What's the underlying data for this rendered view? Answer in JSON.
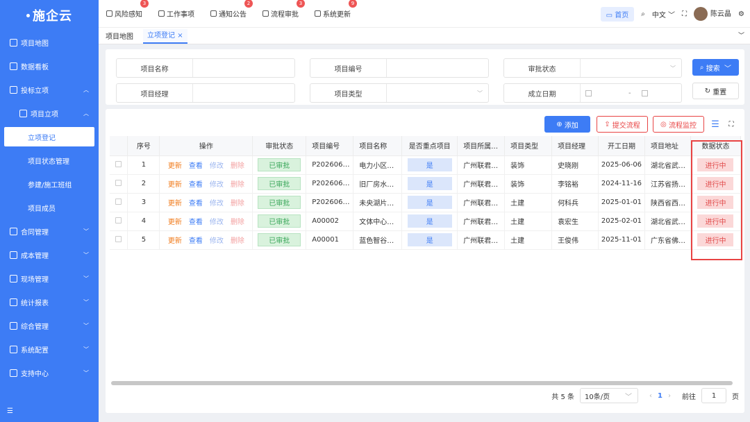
{
  "app": {
    "logo": "施企云"
  },
  "sidebar": {
    "items": [
      {
        "label": "项目地图",
        "icon": "home-icon"
      },
      {
        "label": "数据看板",
        "icon": "monitor-icon"
      },
      {
        "label": "投标立项",
        "icon": "briefcase-icon",
        "chevron": "^"
      },
      {
        "label": "项目立项",
        "icon": "doc-icon",
        "chevron": "^"
      },
      {
        "label": "立项登记"
      },
      {
        "label": "项目状态管理"
      },
      {
        "label": "参建/施工班组"
      },
      {
        "label": "项目成员"
      },
      {
        "label": "合同管理",
        "icon": "contract-icon",
        "chevron": "v"
      },
      {
        "label": "成本管理",
        "icon": "cost-icon",
        "chevron": "v"
      },
      {
        "label": "现场管理",
        "icon": "site-icon",
        "chevron": "v"
      },
      {
        "label": "统计报表",
        "icon": "grid-icon",
        "chevron": "v"
      },
      {
        "label": "综合管理",
        "icon": "table-icon",
        "chevron": "v"
      },
      {
        "label": "系统配置",
        "icon": "grid-icon",
        "chevron": "v"
      },
      {
        "label": "支持中心",
        "icon": "help-icon",
        "chevron": "v"
      }
    ]
  },
  "topbar": {
    "items": [
      {
        "label": "风险感知",
        "badge": "3"
      },
      {
        "label": "工作事项",
        "badge": ""
      },
      {
        "label": "通知公告",
        "badge": "2"
      },
      {
        "label": "流程审批",
        "badge": "3"
      },
      {
        "label": "系统更新",
        "badge": "9"
      }
    ],
    "home": "首页",
    "lang": "中文",
    "user": "陈云晶"
  },
  "tabs": {
    "items": [
      "项目地图",
      "立项登记"
    ],
    "close": "×"
  },
  "filter": {
    "project_name": "项目名称",
    "project_code": "项目编号",
    "approval_status": "审批状态",
    "manager": "项目经理",
    "project_type": "项目类型",
    "found_date": "成立日期",
    "date_sep": "-",
    "search": "搜索",
    "reset": "重置"
  },
  "toolbar": {
    "add": "添加",
    "submit": "提交流程",
    "monitor": "流程监控"
  },
  "table": {
    "headers": [
      "序号",
      "操作",
      "审批状态",
      "项目编号",
      "项目名称",
      "是否重点项目",
      "项目所属…",
      "项目类型",
      "项目经理",
      "开工日期",
      "项目地址",
      "数据状态"
    ],
    "actions": {
      "update": "更新",
      "view": "查看",
      "edit": "修改",
      "delete": "删除"
    },
    "rows": [
      {
        "no": "1",
        "status": "已审批",
        "code": "P202606…",
        "name": "电力小区…",
        "key": "是",
        "org": "广州联君…",
        "type": "装饰",
        "manager": "史晓刚",
        "date": "2025-06-06",
        "addr": "湖北省武…",
        "state": "进行中"
      },
      {
        "no": "2",
        "status": "已审批",
        "code": "P202606…",
        "name": "旧厂房水…",
        "key": "是",
        "org": "广州联君…",
        "type": "装饰",
        "manager": "李铭裕",
        "date": "2024-11-16",
        "addr": "江苏省扬…",
        "state": "进行中"
      },
      {
        "no": "3",
        "status": "已审批",
        "code": "P202606…",
        "name": "未央湖片…",
        "key": "是",
        "org": "广州联君…",
        "type": "土建",
        "manager": "何科兵",
        "date": "2025-01-01",
        "addr": "陕西省西…",
        "state": "进行中"
      },
      {
        "no": "4",
        "status": "已审批",
        "code": "A00002",
        "name": "文体中心…",
        "key": "是",
        "org": "广州联君…",
        "type": "土建",
        "manager": "袁宏生",
        "date": "2025-02-01",
        "addr": "湖北省武…",
        "state": "进行中"
      },
      {
        "no": "5",
        "status": "已审批",
        "code": "A00001",
        "name": "蓝色智谷…",
        "key": "是",
        "org": "广州联君…",
        "type": "土建",
        "manager": "王俊伟",
        "date": "2025-11-01",
        "addr": "广东省佛…",
        "state": "进行中"
      }
    ]
  },
  "pager": {
    "total": "共 5 条",
    "page_size": "10条/页",
    "current": "1",
    "goto": "前往",
    "goto_value": "1",
    "page_unit": "页"
  },
  "colors": {
    "primary": "#3d7cf5",
    "danger": "#e84343"
  }
}
